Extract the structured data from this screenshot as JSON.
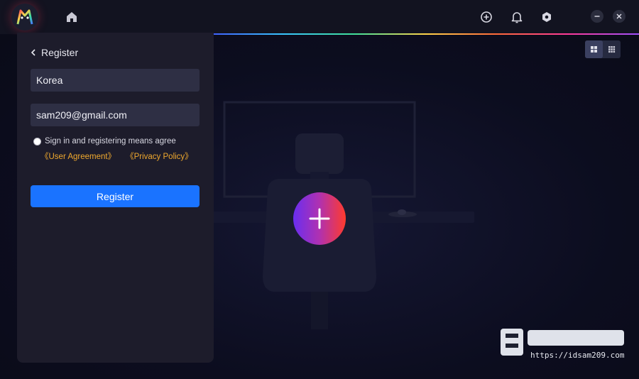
{
  "titlebar": {
    "icons": [
      "app-logo-icon",
      "home-icon",
      "add-circle-icon",
      "bell-icon",
      "settings-hex-icon",
      "minimize-icon",
      "close-icon"
    ]
  },
  "view_toggle": {
    "icons": [
      "grid-large-icon",
      "grid-small-icon"
    ]
  },
  "register_panel": {
    "back_label": "Register",
    "region_value": "Korea",
    "email_value": "sam209@gmail.com",
    "agree_text": "Sign in and registering means agree",
    "user_agreement": "《User Agreement》",
    "privacy_policy": "《Privacy Policy》",
    "register_button": "Register"
  },
  "watermark": {
    "url": "https://idsam209.com"
  },
  "colors": {
    "accent": "#1a73ff",
    "link": "#f0a92e",
    "panel": "#1d1c2b"
  }
}
